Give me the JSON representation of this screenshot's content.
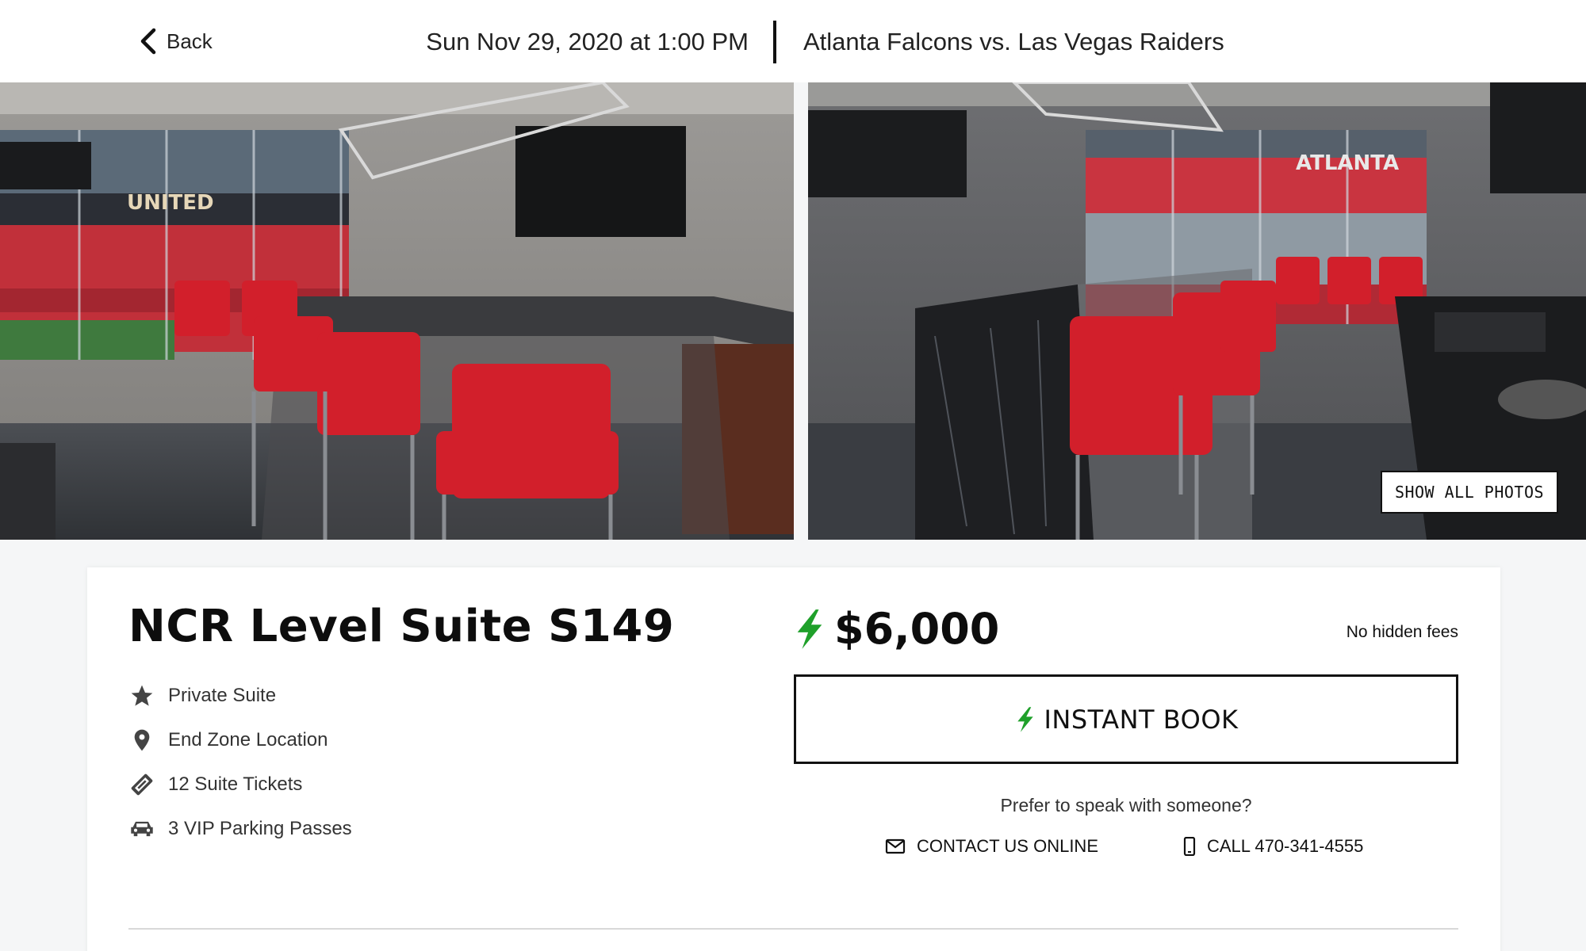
{
  "header": {
    "back_label": "Back",
    "event_date": "Sun Nov 29, 2020 at 1:00 PM",
    "event_name": "Atlanta Falcons vs. Las Vegas Raiders"
  },
  "gallery": {
    "show_all_label": "SHOW ALL PHOTOS",
    "left_photo_signage": "UNITED",
    "right_photo_signage": "ATLANTA"
  },
  "listing": {
    "title": "NCR Level Suite S149",
    "features": [
      {
        "icon": "star-icon",
        "label": "Private Suite"
      },
      {
        "icon": "location-pin-icon",
        "label": "End Zone Location"
      },
      {
        "icon": "ticket-icon",
        "label": "12 Suite Tickets"
      },
      {
        "icon": "car-icon",
        "label": "3 VIP Parking Passes"
      }
    ],
    "price": "$6,000",
    "fees_note": "No hidden fees",
    "instant_book_label": "INSTANT BOOK",
    "prefer_text": "Prefer to speak with someone?",
    "contact_label": "CONTACT US ONLINE",
    "call_label": "CALL 470-341-4555"
  },
  "colors": {
    "accent_green": "#1fa02a",
    "suite_red": "#d21f2b",
    "text_dark": "#111111"
  }
}
